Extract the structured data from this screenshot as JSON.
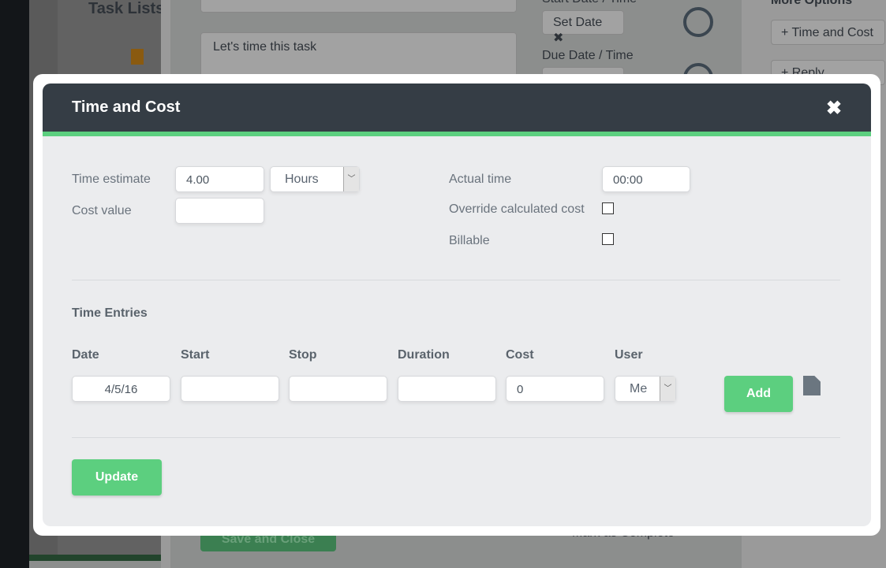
{
  "background": {
    "task_lists": "Task Lists",
    "description": "Let's time this task",
    "start_date_label": "Start Date / Time",
    "set_date": "Set Date",
    "due_date_label": "Due Date / Time",
    "more_options": "More Options",
    "time_and_cost": "+ Time and Cost",
    "reply_expected": "+ Reply Expected",
    "save_and_close": "Save and Close",
    "mark_complete": "Mark as Complete"
  },
  "modal": {
    "title": "Time and Cost",
    "close": "✖",
    "time_estimate_label": "Time estimate",
    "time_estimate_value": "4.00",
    "unit_value": "Hours",
    "cost_value_label": "Cost value",
    "cost_value": "",
    "actual_time_label": "Actual time",
    "actual_time_value": "00:00",
    "override_label": "Override calculated cost",
    "override_checked": false,
    "billable_label": "Billable",
    "billable_checked": false,
    "time_entries_title": "Time Entries",
    "columns": [
      "Date",
      "Start",
      "Stop",
      "Duration",
      "Cost",
      "User"
    ],
    "entry": {
      "date": "4/5/16",
      "start": "",
      "stop": "",
      "duration": "",
      "cost": "0",
      "user": "Me"
    },
    "add_label": "Add",
    "update_label": "Update"
  },
  "colors": {
    "accent": "#5ccf7f",
    "header": "#353d45"
  }
}
